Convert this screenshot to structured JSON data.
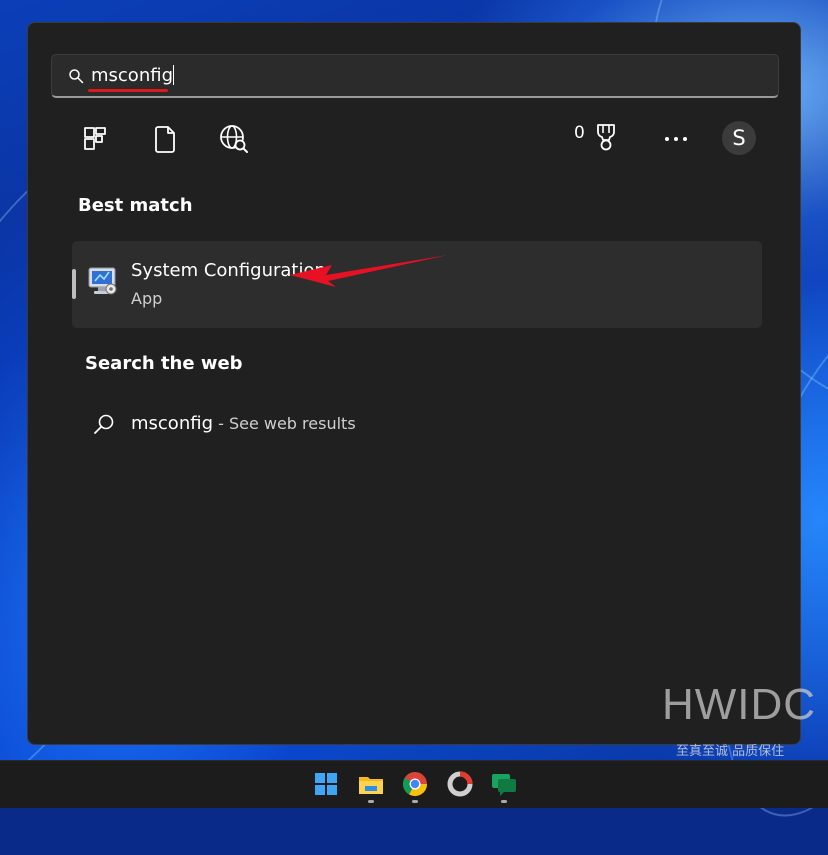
{
  "search": {
    "query": "msconfig"
  },
  "toolbar": {
    "icons": [
      "apps-icon",
      "documents-icon",
      "web-icon"
    ],
    "points": "0",
    "avatar_initial": "S"
  },
  "best_match": {
    "heading": "Best match",
    "result": {
      "title": "System Configuration",
      "subtitle": "App"
    }
  },
  "search_web": {
    "heading": "Search the web",
    "query": "msconfig",
    "suffix": " - See web results"
  },
  "watermark": {
    "title": "HWIDC",
    "subtitle": "至真至诚 品质保住"
  },
  "taskbar": {
    "icons": [
      "windows-start-icon",
      "file-explorer-icon",
      "chrome-icon",
      "browser-icon",
      "chat-icon"
    ]
  },
  "colors": {
    "panel": "#202020",
    "accent_red": "#e81123",
    "row": "#2d2d2d"
  }
}
